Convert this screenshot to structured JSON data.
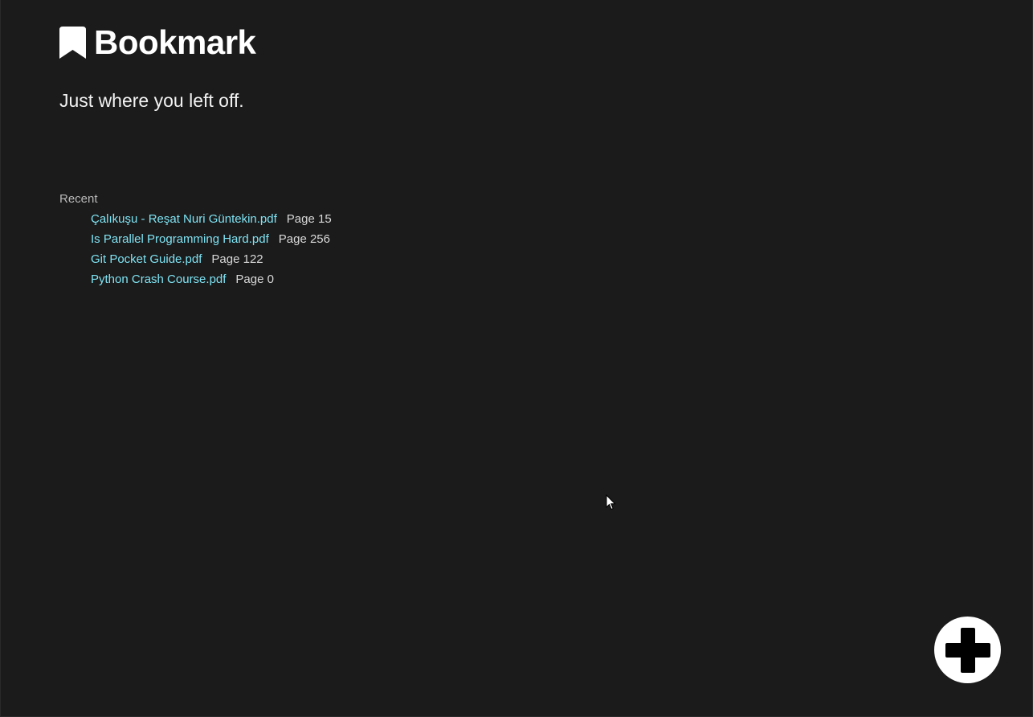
{
  "app": {
    "title": "Bookmark",
    "tagline": "Just where you left off."
  },
  "recent": {
    "heading": "Recent",
    "items": [
      {
        "file": "Çalıkuşu - Reşat Nuri Güntekin.pdf",
        "page": "Page 15"
      },
      {
        "file": "Is Parallel Programming Hard.pdf",
        "page": "Page 256"
      },
      {
        "file": "Git Pocket Guide.pdf",
        "page": "Page 122"
      },
      {
        "file": "Python Crash Course.pdf",
        "page": "Page 0"
      }
    ]
  },
  "icons": {
    "logo": "bookmark-icon",
    "add": "plus-icon"
  },
  "colors": {
    "background": "#1b1b1b",
    "link": "#7fe3f3",
    "text": "#ffffff",
    "muted": "#b9b9b9"
  }
}
